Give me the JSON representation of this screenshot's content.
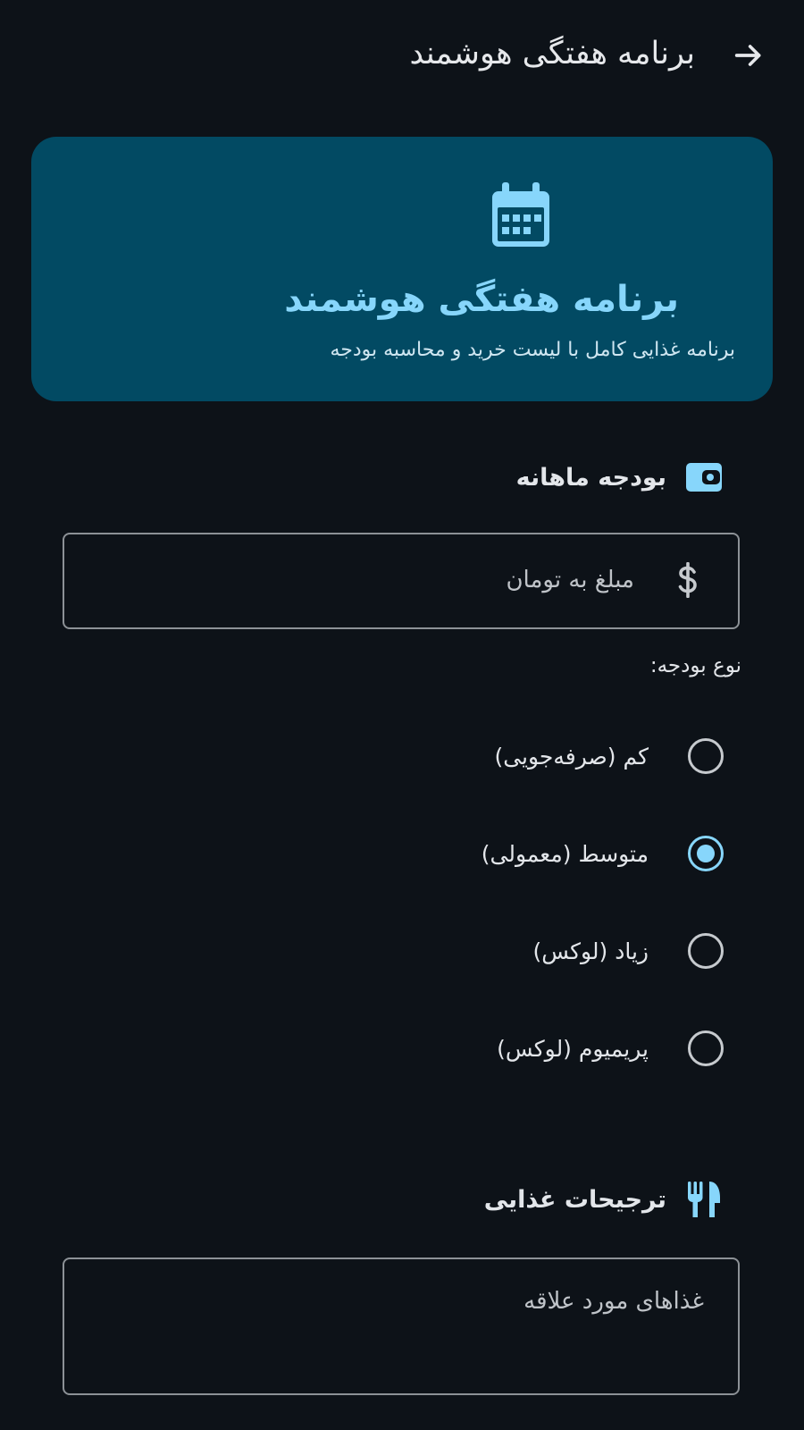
{
  "appbar": {
    "title": "برنامه هفتگی هوشمند",
    "back_icon": "arrow-right-icon"
  },
  "hero": {
    "icon": "calendar-icon",
    "title": "برنامه هفتگی هوشمند",
    "subtitle": "برنامه غذایی کامل با لیست خرید و محاسبه بودجه"
  },
  "budget": {
    "icon": "wallet-icon",
    "title": "بودجه ماهانه",
    "amount_placeholder": "مبلغ به تومان",
    "amount_value": "",
    "amount_icon": "dollar-icon",
    "type_label": "نوع بودجه:",
    "options": [
      {
        "label": "کم (صرفه‌جویی)",
        "checked": false
      },
      {
        "label": "متوسط (معمولی)",
        "checked": true
      },
      {
        "label": "زیاد (لوکس)",
        "checked": false
      },
      {
        "label": "پریمیوم (لوکس)",
        "checked": false
      }
    ]
  },
  "food": {
    "icon": "restaurant-icon",
    "title": "ترجیحات غذایی",
    "favorites_placeholder": "غذاهای مورد علاقه",
    "favorites_value": ""
  },
  "colors": {
    "background": "#0d1218",
    "hero_bg": "#024a63",
    "accent": "#87d6fb",
    "text": "#e3e6ea"
  }
}
